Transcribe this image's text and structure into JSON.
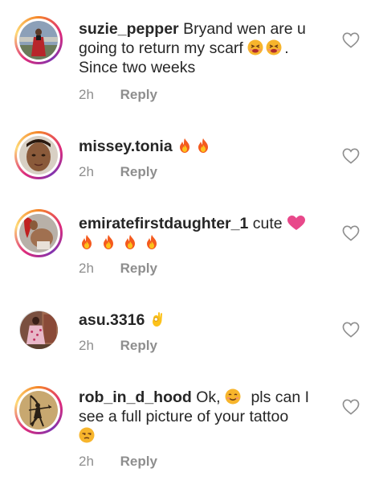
{
  "comments": [
    {
      "username": "suzie_pepper",
      "text_before": "Bryand wen are u going to return my scarf",
      "emojis_mid": [
        "tired-face",
        "tired-face"
      ],
      "text_after": ". Since two weeks",
      "time": "2h",
      "reply": "Reply",
      "avatar_ring": true
    },
    {
      "username": "missey.tonia",
      "emojis": [
        "fire",
        "fire"
      ],
      "time": "2h",
      "reply": "Reply",
      "avatar_ring": true
    },
    {
      "username": "emiratefirstdaughter_1",
      "text": "cute",
      "emojis": [
        "pink-heart",
        "fire",
        "fire",
        "fire",
        "fire"
      ],
      "time": "2h",
      "reply": "Reply",
      "avatar_ring": true
    },
    {
      "username": "asu.3316",
      "emojis": [
        "ok-hand"
      ],
      "time": "2h",
      "reply": "Reply",
      "avatar_ring": false
    },
    {
      "username": "rob_in_d_hood",
      "text_before": "Ok,",
      "emojis_mid": [
        "smiling-face"
      ],
      "text_after": "pls can I see a full picture of your tattoo",
      "emojis_end": [
        "unamused-face"
      ],
      "time": "2h",
      "reply": "Reply",
      "avatar_ring": true
    }
  ],
  "icons": {
    "like": "heart-outline-icon"
  },
  "colors": {
    "username": "#262626",
    "meta": "#8e8e8e",
    "like_icon": "#8e8e8e"
  }
}
